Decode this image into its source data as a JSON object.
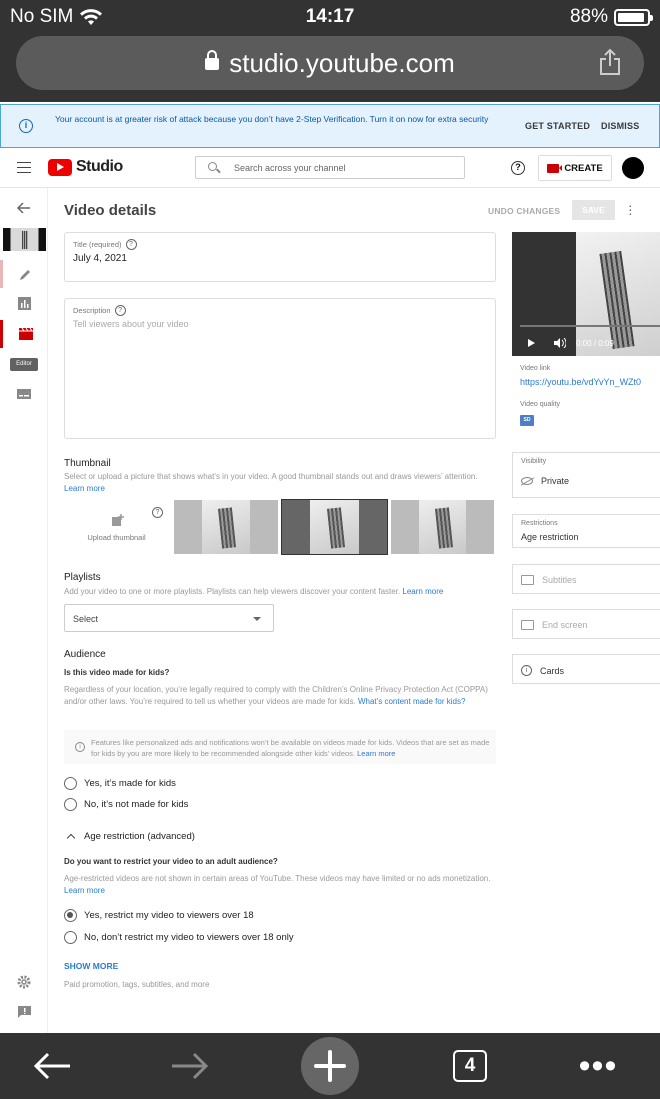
{
  "status": {
    "carrier": "No SIM",
    "time": "14:17",
    "battery": "88%"
  },
  "browser": {
    "url": "studio.youtube.com",
    "tab_count": "4"
  },
  "banner": {
    "text": "Your account is at greater risk of attack because you don’t have 2-Step Verification. Turn it on now for extra security",
    "get_started": "GET STARTED",
    "dismiss": "DISMISS"
  },
  "header": {
    "logo_text": "Studio",
    "search_placeholder": "Search across your channel",
    "create_label": "CREATE"
  },
  "sidebar": {
    "editor_tooltip": "Editor"
  },
  "details": {
    "page_title": "Video details",
    "undo_label": "UNDO CHANGES",
    "save_label": "SAVE",
    "title_label": "Title (required)",
    "title_value": "July 4, 2021",
    "description_label": "Description",
    "description_placeholder": "Tell viewers about your video",
    "thumbnail_heading": "Thumbnail",
    "thumbnail_desc": "Select or upload a picture that shows what’s in your video. A good thumbnail stands out and draws viewers’ attention.",
    "thumbnail_link": "Learn more",
    "upload_thumbnail": "Upload thumbnail",
    "playlists_heading": "Playlists",
    "playlists_desc": "Add your video to one or more playlists. Playlists can help viewers discover your content faster.",
    "playlists_link": "Learn more",
    "playlists_select": "Select",
    "audience_heading": "Audience",
    "kids_question": "Is this video made for kids?",
    "kids_desc": "Regardless of your location, you’re legally required to comply with the Children’s Online Privacy Protection Act (COPPA) and/or other laws. You’re required to tell us whether your videos are made for kids.",
    "kids_link": "What’s content made for kids?",
    "notice_text": "Features like personalized ads and notifications won’t be available on videos made for kids. Videos that are set as made for kids by you are more likely to be recommended alongside other kids’ videos.",
    "notice_link": "Learn more",
    "kids_yes": "Yes, it’s made for kids",
    "kids_no": "No, it’s not made for kids",
    "age_advanced": "Age restriction (advanced)",
    "age_question": "Do you want to restrict your video to an adult audience?",
    "age_desc": "Age-restricted videos are not shown in certain areas of YouTube. These videos may have limited or no ads monetization.",
    "age_link": "Learn more",
    "age_yes": "Yes, restrict my video to viewers over 18",
    "age_no": "No, don’t restrict my video to viewers over 18 only",
    "show_more": "SHOW MORE",
    "show_more_desc": "Paid promotion, tags, subtitles, and more"
  },
  "right_panel": {
    "video_time": "0:00 / 0:09",
    "video_link_label": "Video link",
    "video_link": "https://youtu.be/vdYvYn_WZt0",
    "video_quality_label": "Video quality",
    "quality_badge": "SD",
    "visibility_label": "Visibility",
    "visibility_value": "Private",
    "restrictions_label": "Restrictions",
    "restrictions_value": "Age restriction",
    "subtitles": "Subtitles",
    "end_screen": "End screen",
    "cards": "Cards"
  }
}
